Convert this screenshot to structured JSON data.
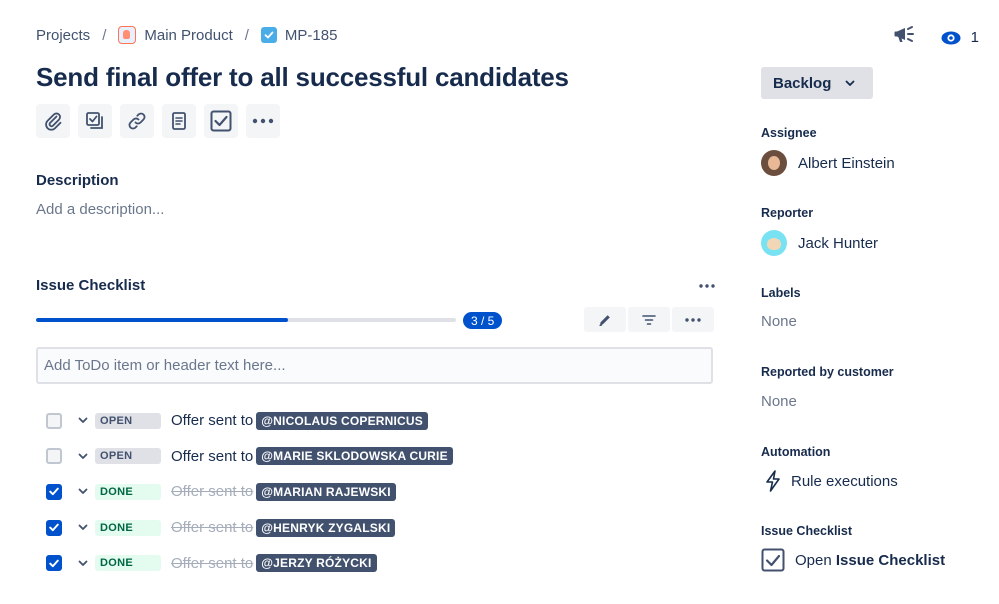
{
  "breadcrumb": {
    "projects": "Projects",
    "separator": "/",
    "project_name": "Main Product",
    "issue_key": "MP-185"
  },
  "header": {
    "watchers_count": "1"
  },
  "issue": {
    "title": "Send final offer to all successful candidates"
  },
  "description": {
    "heading": "Description",
    "placeholder": "Add a description..."
  },
  "checklist": {
    "heading": "Issue Checklist",
    "progress_label": "3 / 5",
    "progress_fraction": 0.6,
    "input_placeholder": "Add ToDo item or header text here...",
    "items": [
      {
        "checked": false,
        "status": "OPEN",
        "text": "Offer sent to",
        "mention": "@NICOLAUS COPERNICUS"
      },
      {
        "checked": false,
        "status": "OPEN",
        "text": "Offer sent to",
        "mention": "@MARIE SKLODOWSKA CURIE"
      },
      {
        "checked": true,
        "status": "DONE",
        "text": "Offer sent to",
        "mention": "@MARIAN RAJEWSKI"
      },
      {
        "checked": true,
        "status": "DONE",
        "text": "Offer sent to",
        "mention": "@HENRYK ZYGALSKI"
      },
      {
        "checked": true,
        "status": "DONE",
        "text": "Offer sent to",
        "mention": "@JERZY RÓŻYCKI"
      }
    ]
  },
  "sidebar": {
    "status_button": "Backlog",
    "assignee_label": "Assignee",
    "assignee_name": "Albert Einstein",
    "reporter_label": "Reporter",
    "reporter_name": "Jack Hunter",
    "labels_label": "Labels",
    "labels_value": "None",
    "reported_by_customer_label": "Reported by customer",
    "reported_by_customer_value": "None",
    "automation_label": "Automation",
    "automation_link": "Rule executions",
    "checklist_label": "Issue Checklist",
    "checklist_link_prefix": "Open",
    "checklist_link_bold": "Issue Checklist"
  },
  "colors": {
    "accent": "#0052cc",
    "text": "#172b4d",
    "muted": "#6b778c",
    "done_bg": "#e3fcef",
    "done_text": "#006644",
    "mention_bg": "#42526e"
  },
  "icons": {
    "toolbar": [
      "paperclip-icon",
      "child-issue-icon",
      "link-icon",
      "document-icon",
      "checklist-icon",
      "more-icon"
    ],
    "checklist_actions": [
      "pencil-icon",
      "filter-icon",
      "more-icon"
    ]
  }
}
